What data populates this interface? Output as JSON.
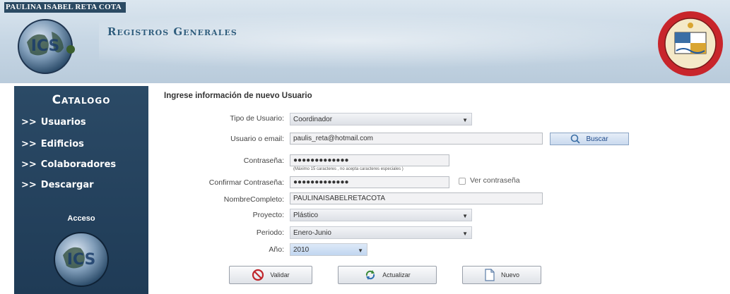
{
  "header": {
    "name": "PAULINA ISABEL RETA COTA",
    "title": "Registros Generales"
  },
  "sidebar": {
    "title": "Catalogo",
    "items": [
      {
        "arrows": ">>",
        "label": "Usuarios"
      },
      {
        "arrows": ">>",
        "label": "Edificios"
      },
      {
        "arrows": ">>",
        "label": "Colaboradores"
      },
      {
        "arrows": ">>",
        "label": "Descargar"
      }
    ],
    "acceso": "Acceso"
  },
  "form": {
    "title": "Ingrese información de nuevo Usuario",
    "tipo_label": "Tipo de Usuario:",
    "tipo_value": "Coordinador",
    "usuario_label": "Usuario o email:",
    "usuario_value": "paulis_reta@hotmail.com",
    "buscar_label": "Buscar",
    "contrasena_label": "Contraseña:",
    "contrasena_value": "●●●●●●●●●●●●●",
    "contrasena_hint": "(Máximo 15 caracteres , no acepta caracteres especiales )",
    "confirmar_label": "Confirmar Contraseña:",
    "confirmar_value": "●●●●●●●●●●●●●",
    "ver_label": "Ver contraseña",
    "nombre_label": "NombreCompleto:",
    "nombre_value": "PAULINAISABELRETACOTA",
    "proyecto_label": "Proyecto:",
    "proyecto_value": "Plástico",
    "periodo_label": "Periodo:",
    "periodo_value": "Enero-Junio",
    "anio_label": "Año:",
    "anio_value": "2010",
    "validar_label": "Validar",
    "actualizar_label": "Actualizar",
    "nuevo_label": "Nuevo"
  },
  "colors": {
    "sidebar": "#1f3b56",
    "header": "#c6d6e4",
    "accent": "#2f5d7d"
  }
}
